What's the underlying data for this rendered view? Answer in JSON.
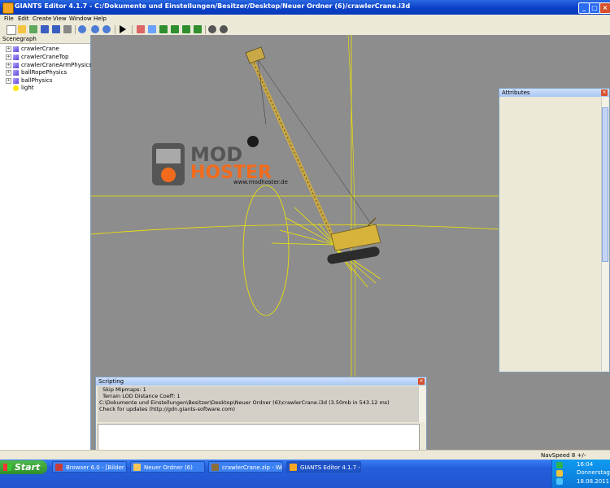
{
  "window": {
    "title": "GIANTS Editor 4.1.7 - C:/Dokumente und Einstellungen/Besitzer/Desktop/Neuer Ordner (6)/crawlerCrane.i3d"
  },
  "menu": [
    "File",
    "Edit",
    "Create",
    "View",
    "Window",
    "Help"
  ],
  "scenegraph": {
    "title": "Scenegraph",
    "items": [
      "crawlerCrane",
      "crawlerCraneTop",
      "crawlerCraneArmPhysics",
      "ballRopePhysics",
      "ballPhysics",
      "light"
    ]
  },
  "watermark": {
    "url": "www.modhoster.de"
  },
  "attributes": {
    "title": "Attributes"
  },
  "scripting": {
    "title": "Scripting",
    "lines": [
      "  Skip Mipmaps: 1",
      "  Terrain LOD Distance Coeff: 1",
      "C:\\Dokumente und Einstellungen\\Besitzer\\Desktop\\Neuer Ordner (6)\\crawlerCrane.i3d (3.50mb in 543.12 ms)",
      "Check for updates (http://gdn.giants-software.com)"
    ]
  },
  "status": {
    "navspeed": "NavSpeed 8 +/-"
  },
  "taskbar": {
    "start": "Start",
    "tasks": [
      "Browser 6.0 - [Bilder ...",
      "Neuer Ordner (6)",
      "crawlerCrane.zip - Wi...",
      "GIANTS Editor 4.1.7 -..."
    ],
    "clock": {
      "time": "16:04",
      "day": "Donnerstag",
      "date": "18.08.2011"
    }
  },
  "colors": {
    "viewport_bg": "#8d8d8d",
    "gizmo": "#f2e600",
    "titlebar": "#0a3fc8",
    "taskbar": "#245fdc"
  }
}
